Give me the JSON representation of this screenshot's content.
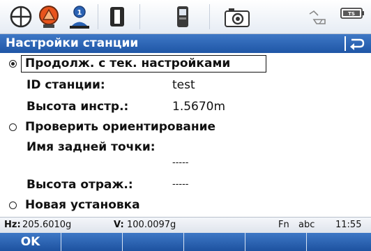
{
  "title": "Настройки станции",
  "options": [
    {
      "label": "Продолж. с тек. настройками",
      "selected": true
    },
    {
      "label": "Проверить ориентирование",
      "selected": false
    },
    {
      "label": "Новая установка",
      "selected": false
    }
  ],
  "fields": {
    "station_id": {
      "label": "ID станции:",
      "value": "test"
    },
    "instrument_height": {
      "label": "Высота инстр.:",
      "value": "1.5670m"
    },
    "backsight_name": {
      "label": "Имя задней точки:",
      "value": "-----"
    },
    "reflector_height": {
      "label": "Высота отраж.:",
      "value": "-----"
    }
  },
  "status": {
    "hz_label": "Hz:",
    "hz_value": "205.6010g",
    "v_label": "V:",
    "v_value": "100.0097g",
    "fn": "Fn",
    "input_mode": "abc",
    "time": "11:55"
  },
  "softkeys": [
    "OK",
    "",
    "",
    "",
    "",
    ""
  ],
  "icons": {
    "crosshair": "crosshair-icon",
    "prism": "prism-icon",
    "person": "person-icon",
    "reflector": "reflector-icon",
    "device": "device-icon",
    "camera": "camera-icon",
    "signal": "signal-icon",
    "battery": "battery-icon",
    "back": "back-arrow-icon"
  },
  "colors": {
    "accent": "#2a62b4",
    "title_text": "#ffffff",
    "prism_orange": "#e8541c"
  }
}
